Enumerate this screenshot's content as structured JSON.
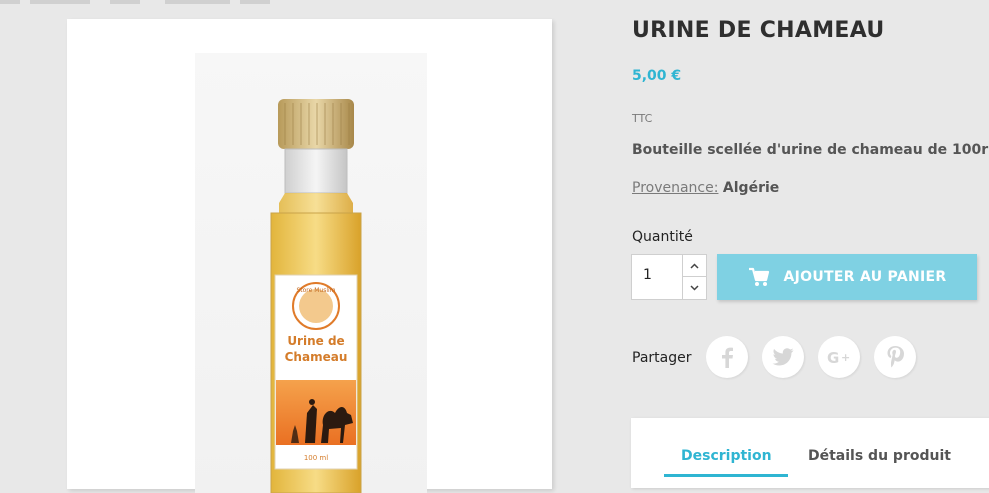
{
  "product": {
    "title": "URINE DE CHAMEAU",
    "price": "5,00 €",
    "tax_label": "TTC",
    "short_description": "Bouteille scellée d'urine de chameau de 100r",
    "provenance_label": "Provenance:",
    "provenance_value": "Algérie"
  },
  "image": {
    "label_brand": "Store Muslim",
    "label_line1": "Urine de",
    "label_line2": "Chameau",
    "label_volume": "100 ml"
  },
  "quantity": {
    "label": "Quantité",
    "value": "1"
  },
  "cart": {
    "add_label": "AJOUTER AU PANIER",
    "icon": "shopping-cart-icon"
  },
  "share": {
    "label": "Partager",
    "networks": [
      "facebook-icon",
      "twitter-icon",
      "google-plus-icon",
      "pinterest-icon"
    ]
  },
  "tabs": [
    {
      "label": "Description",
      "active": true
    },
    {
      "label": "Détails du produit",
      "active": false
    }
  ],
  "colors": {
    "accent": "#2fb5d2",
    "button": "#7fd1e3",
    "background": "#e8e8e8"
  }
}
